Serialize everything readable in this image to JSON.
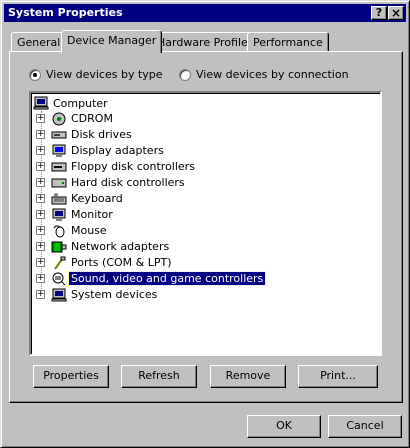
{
  "window": {
    "title": "System Properties",
    "help": "?",
    "close": "×"
  },
  "tabs": [
    {
      "label": "General"
    },
    {
      "label": "Device Manager"
    },
    {
      "label": "Hardware Profiles"
    },
    {
      "label": "Performance"
    }
  ],
  "view": {
    "by_type": "View devices by type",
    "by_connection": "View devices by connection",
    "selected": "by_type"
  },
  "tree": {
    "root": "Computer",
    "items": [
      {
        "label": "CDROM",
        "icon": "cdrom-icon"
      },
      {
        "label": "Disk drives",
        "icon": "disk-drive-icon"
      },
      {
        "label": "Display adapters",
        "icon": "display-icon"
      },
      {
        "label": "Floppy disk controllers",
        "icon": "floppy-icon"
      },
      {
        "label": "Hard disk controllers",
        "icon": "hard-disk-icon"
      },
      {
        "label": "Keyboard",
        "icon": "keyboard-icon"
      },
      {
        "label": "Monitor",
        "icon": "monitor-icon"
      },
      {
        "label": "Mouse",
        "icon": "mouse-icon"
      },
      {
        "label": "Network adapters",
        "icon": "network-icon"
      },
      {
        "label": "Ports (COM & LPT)",
        "icon": "port-icon"
      },
      {
        "label": "Sound, video and game controllers",
        "icon": "sound-icon",
        "selected": true
      },
      {
        "label": "System devices",
        "icon": "system-icon"
      }
    ]
  },
  "actions": {
    "properties": "Properties",
    "refresh": "Refresh",
    "remove": "Remove",
    "print": "Print..."
  },
  "footer": {
    "ok": "OK",
    "cancel": "Cancel"
  },
  "colors": {
    "face": "#c0c0c0",
    "title": "#000080",
    "selection": "#000080"
  }
}
